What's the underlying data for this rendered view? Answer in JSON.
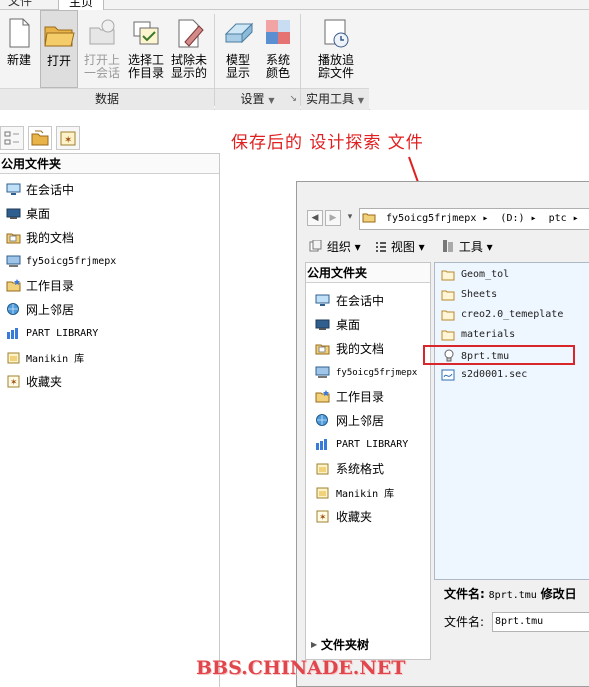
{
  "menu": {
    "file": "文件",
    "home": "主页"
  },
  "ribbon": {
    "buttons": {
      "new": "新建",
      "open": "打开",
      "open_last_1": "打开上",
      "open_last_2": "一会话",
      "select_wd_1": "选择工",
      "select_wd_2": "作目录",
      "erase_1": "拭除未",
      "erase_2": "显示的",
      "model_1": "模型",
      "model_2": "显示",
      "sys_1": "系统",
      "sys_2": "颜色",
      "play_1": "播放追",
      "play_2": "踪文件"
    },
    "groups": {
      "data": "数据",
      "settings": "设置",
      "utilities": "实用工具"
    }
  },
  "left": {
    "title": "公用文件夹",
    "items": [
      {
        "label": "在会话中",
        "icon": "monitor-icon"
      },
      {
        "label": "桌面",
        "icon": "desktop-icon"
      },
      {
        "label": "我的文档",
        "icon": "documents-icon"
      },
      {
        "label": "fy5oicg5frjmepx",
        "icon": "computer-icon"
      },
      {
        "label": "工作目录",
        "icon": "working-directory-icon"
      },
      {
        "label": "网上邻居",
        "icon": "network-icon"
      },
      {
        "label": "PART LIBRARY",
        "icon": "library-icon"
      },
      {
        "label": "Manikin 库",
        "icon": "folder-icon"
      },
      {
        "label": "收藏夹",
        "icon": "favorites-icon"
      }
    ]
  },
  "annotation": "保存后的 设计探索 文件",
  "dialog": {
    "crumbs": [
      "fy5oicg5frjmepx ▸",
      "(D:) ▸",
      "ptc ▸"
    ],
    "toolbar": {
      "organize": "组织",
      "views": "视图",
      "tools": "工具"
    },
    "left_title": "公用文件夹",
    "left_items": [
      {
        "label": "在会话中"
      },
      {
        "label": "桌面"
      },
      {
        "label": "我的文档"
      },
      {
        "label": "fy5oicg5frjmepx"
      },
      {
        "label": "工作目录"
      },
      {
        "label": "网上邻居"
      },
      {
        "label": "PART LIBRARY"
      },
      {
        "label": "系统格式"
      },
      {
        "label": "Manikin 库"
      },
      {
        "label": "收藏夹"
      }
    ],
    "files": [
      {
        "name": "Geom_tol",
        "type": "folder"
      },
      {
        "name": "Sheets",
        "type": "folder"
      },
      {
        "name": "creo2.0_temeplate",
        "type": "folder"
      },
      {
        "name": "materials",
        "type": "folder"
      },
      {
        "name": "8prt.tmu",
        "type": "tmu"
      },
      {
        "name": "s2d0001.sec",
        "type": "sec"
      }
    ],
    "filename_label": "文件名:",
    "filename_value": "8prt.tmu",
    "modified_label": "修改日",
    "filename_input_label": "文件名:",
    "filename_input_value": "8prt.tmu",
    "folder_tree": "文件夹树"
  },
  "watermark": "BBS.CHINADE.NET",
  "colors": {
    "annotation": "#e02020",
    "highlight": "#d8262a",
    "watermark": "#e0464b"
  }
}
